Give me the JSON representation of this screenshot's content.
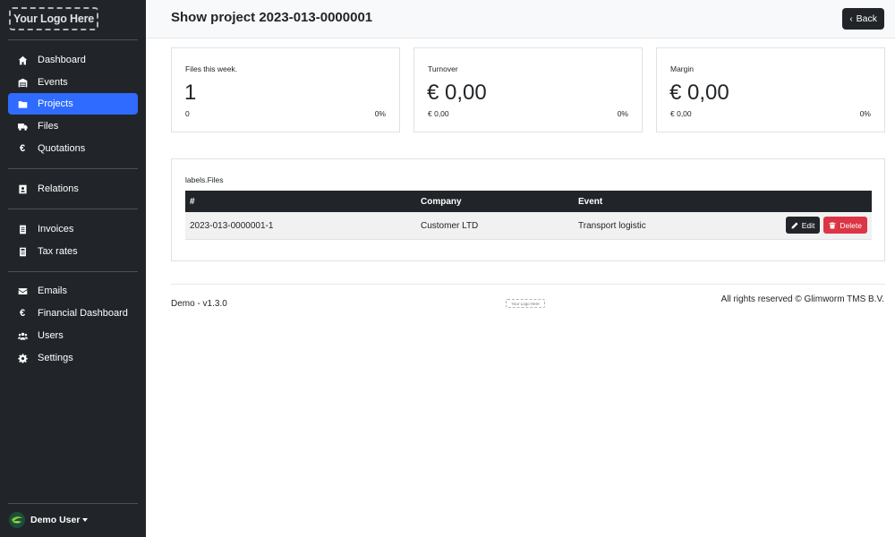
{
  "sidebar": {
    "logo_text": "Your Logo Here",
    "groups": [
      [
        {
          "label": "Dashboard",
          "icon": "home-icon",
          "active": false
        },
        {
          "label": "Events",
          "icon": "warehouse-icon",
          "active": false
        },
        {
          "label": "Projects",
          "icon": "folder-icon",
          "active": true
        },
        {
          "label": "Files",
          "icon": "truck-icon",
          "active": false
        },
        {
          "label": "Quotations",
          "icon": "euro-icon",
          "active": false
        }
      ],
      [
        {
          "label": "Relations",
          "icon": "address-book-icon",
          "active": false
        }
      ],
      [
        {
          "label": "Invoices",
          "icon": "invoice-icon",
          "active": false
        },
        {
          "label": "Tax rates",
          "icon": "calculator-icon",
          "active": false
        }
      ],
      [
        {
          "label": "Emails",
          "icon": "envelope-icon",
          "active": false
        },
        {
          "label": "Financial Dashboard",
          "icon": "euro-icon",
          "active": false
        },
        {
          "label": "Users",
          "icon": "users-icon",
          "active": false
        },
        {
          "label": "Settings",
          "icon": "gear-icon",
          "active": false
        }
      ]
    ],
    "user": {
      "name": "Demo User"
    }
  },
  "header": {
    "title": "Show project 2023-013-0000001",
    "back_label": "Back"
  },
  "stats": [
    {
      "label": "Files this week.",
      "value": "1",
      "sub": "0",
      "pct": "0%"
    },
    {
      "label": "Turnover",
      "value": "€ 0,00",
      "sub": "€ 0,00",
      "pct": "0%"
    },
    {
      "label": "Margin",
      "value": "€ 0,00",
      "sub": "€ 0,00",
      "pct": "0%"
    }
  ],
  "files": {
    "title": "labels.Files",
    "columns": [
      "#",
      "Company",
      "Event"
    ],
    "rows": [
      {
        "id": "2023-013-0000001-1",
        "company": "Customer LTD",
        "event": "Transport logistic"
      }
    ],
    "edit_label": "Edit",
    "delete_label": "Delete"
  },
  "footer": {
    "left": "Demo - v1.3.0",
    "logo_text": "Your Logo Here",
    "right": "All rights reserved © Glimworm TMS B.V."
  },
  "colors": {
    "sidebar_bg": "#212529",
    "active_nav": "#2f6bff",
    "delete": "#dc3545"
  }
}
